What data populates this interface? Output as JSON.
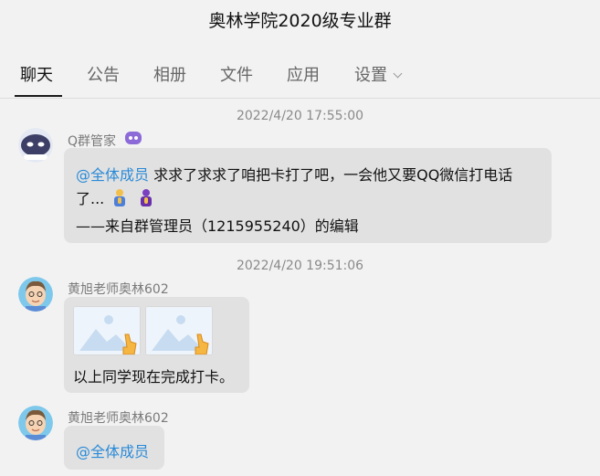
{
  "window": {
    "title": "奥林学院2020级专业群"
  },
  "tabs": [
    {
      "label": "聊天",
      "active": true
    },
    {
      "label": "公告"
    },
    {
      "label": "相册"
    },
    {
      "label": "文件"
    },
    {
      "label": "应用"
    },
    {
      "label": "设置"
    }
  ],
  "messages": [
    {
      "timestamp": "2022/4/20 17:55:00",
      "sender": "Q群管家",
      "sender_badge_icon": "bot-badge-icon",
      "mention": "@全体成员",
      "line1": "求求了求求了咱把卡打了吧，一会他又要QQ微信打电话",
      "line2": "了...",
      "emojis": [
        "praying-person-emoji",
        "praying-person-purple-emoji"
      ],
      "line3": "——来自群管理员（1215955240）的编辑"
    },
    {
      "timestamp": "2022/4/20 19:51:06",
      "sender": "黄旭老师奥林602",
      "images": [
        "image-placeholder-icon",
        "image-placeholder-icon"
      ],
      "text": "以上同学现在完成打卡。"
    },
    {
      "sender": "黄旭老师奥林602",
      "mention": "@全体成员"
    }
  ],
  "colors": {
    "bubble": "#e1e1e1",
    "mention": "#2a8ad8",
    "background": "#f2f2f2"
  }
}
